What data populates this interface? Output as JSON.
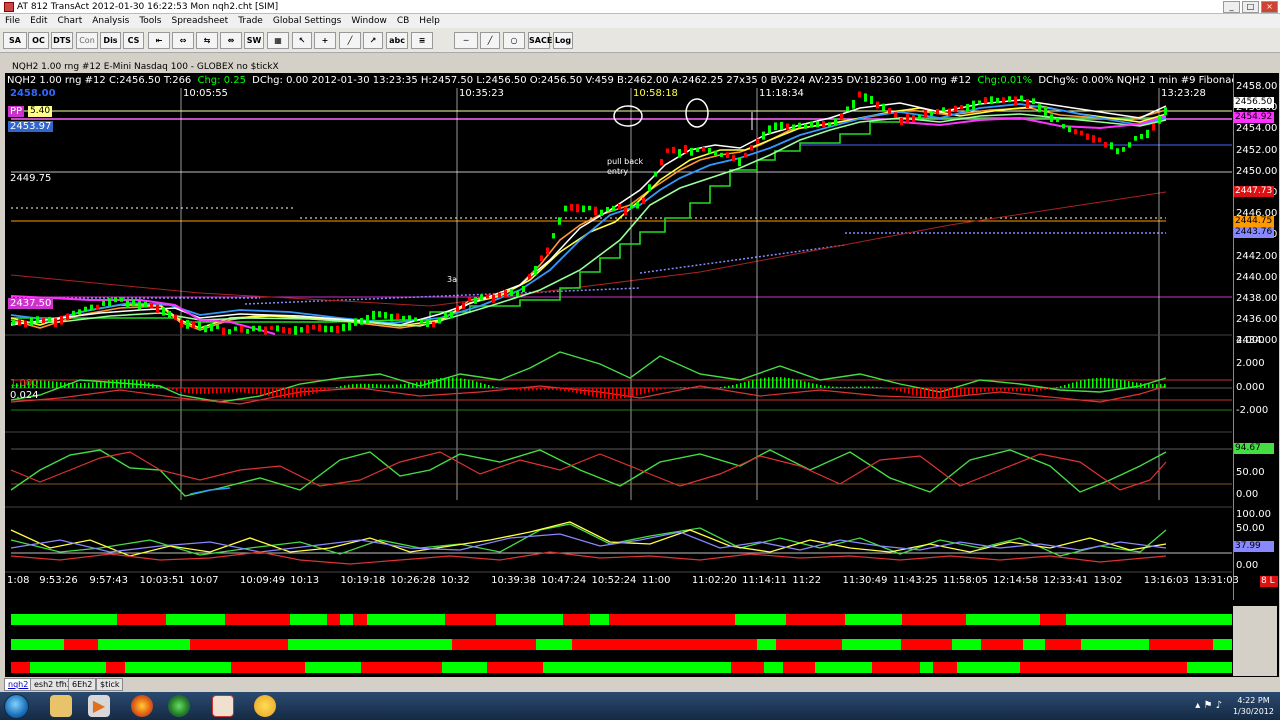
{
  "window": {
    "title": "AT 812 TransAct 2012-01-30 16:22:53 Mon  nqh2.cht [SIM]",
    "min": "_",
    "max": "□",
    "close": "×"
  },
  "menu": [
    "File",
    "Edit",
    "Chart",
    "Analysis",
    "Tools",
    "Spreadsheet",
    "Trade",
    "Global Settings",
    "Window",
    "CB",
    "Help"
  ],
  "toolbar": {
    "sa": "SA",
    "oc": "OC",
    "dts": "DTS",
    "con": "Con",
    "dis": "Dis",
    "cs": "CS",
    "sw": "SW",
    "abc": "abc",
    "sace": "SACE",
    "log": "Log",
    "tool_icons": [
      "pointer-icon",
      "crosshair-icon",
      "line-icon",
      "ray-icon",
      "fibonacci-icon",
      "hline-icon",
      "trendline-icon",
      "ellipse-icon"
    ]
  },
  "chart": {
    "header": {
      "left": "NQH2  1.00 rng  #12  C:2456.50  T:266",
      "chg_label": "Chg: 0.25",
      "mid": "DChg: 0.00  2012-01-30  13:23:35  H:2457.50  L:2456.50  O:2456.50  V:459  B:2462.00  A:2462.25  27x35  0  BV:224  AV:235  DV:182360  1.00 rng  #12",
      "chg_pct": "Chg:0.01%",
      "right": "DChg%: 0.00%   NQH2  1 min   #9 Fibonacci"
    },
    "sub_title": "NQH2  1.00 rng  #12   E-Mini Nasdaq 100  -  GLOBEX   no $tickX",
    "left_labels": {
      "top": "2458.00",
      "pp": "PP",
      "pp_value": "5.40",
      "blue_box": "2453.97",
      "level_2449": "2449.75",
      "level_2437": "2437.50",
      "osc_a": "1.000",
      "osc_b": "0.024"
    },
    "time_markers": [
      "10:05:55",
      "10:35:23",
      "10:58:18",
      "11:18:34",
      "13:23:28"
    ],
    "annotations": {
      "pullback_1": "pull back",
      "pullback_2": "entry",
      "threeA": "3a"
    },
    "price_axis": [
      "2458.00",
      "2456.00",
      "2454.00",
      "2452.00",
      "2450.00",
      "2448.00",
      "2446.00",
      "2444.00",
      "2442.00",
      "2440.00",
      "2438.00",
      "2436.00",
      "2434.00"
    ],
    "price_boxes": [
      {
        "label": "2456.50",
        "color": "#ffffff"
      },
      {
        "label": "2454.92",
        "color": "#ff33ff"
      },
      {
        "label": "2447.73",
        "color": "#dd1111"
      },
      {
        "label": "2444.75",
        "color": "#ff9900"
      },
      {
        "label": "2443.76",
        "color": "#8888ff"
      }
    ],
    "osc1_axis": [
      "4.000",
      "2.000",
      "0.000",
      "-2.000"
    ],
    "osc2_axis": [
      "94.67",
      "50.00",
      "0.00"
    ],
    "osc3_axis": [
      "100.00",
      "50.00",
      "37.99",
      "0.00"
    ],
    "time_axis": [
      "1:08",
      "9:53:26",
      "9:57:43",
      "10:03:51",
      "10:07",
      "10:09:49",
      "10:13",
      "10:19:18",
      "10:26:28",
      "10:32",
      "10:39:38",
      "10:47:24",
      "10:52:24",
      "11:00",
      "11:02:20",
      "11:14:11",
      "11:22",
      "11:30:49",
      "11:43:25",
      "11:58:05",
      "12:14:58",
      "12:33:41",
      "13:02",
      "13:16:03",
      "13:31:03"
    ],
    "corner_badge": "8 L"
  },
  "tabs": [
    "nqh2",
    "esh2 tfh2",
    "6Eh2",
    "$tick"
  ],
  "taskbar": {
    "time": "4:22 PM",
    "date": "1/30/2012"
  },
  "colors": {
    "up": "#00ff00",
    "down": "#ff0000",
    "background": "#000000"
  }
}
